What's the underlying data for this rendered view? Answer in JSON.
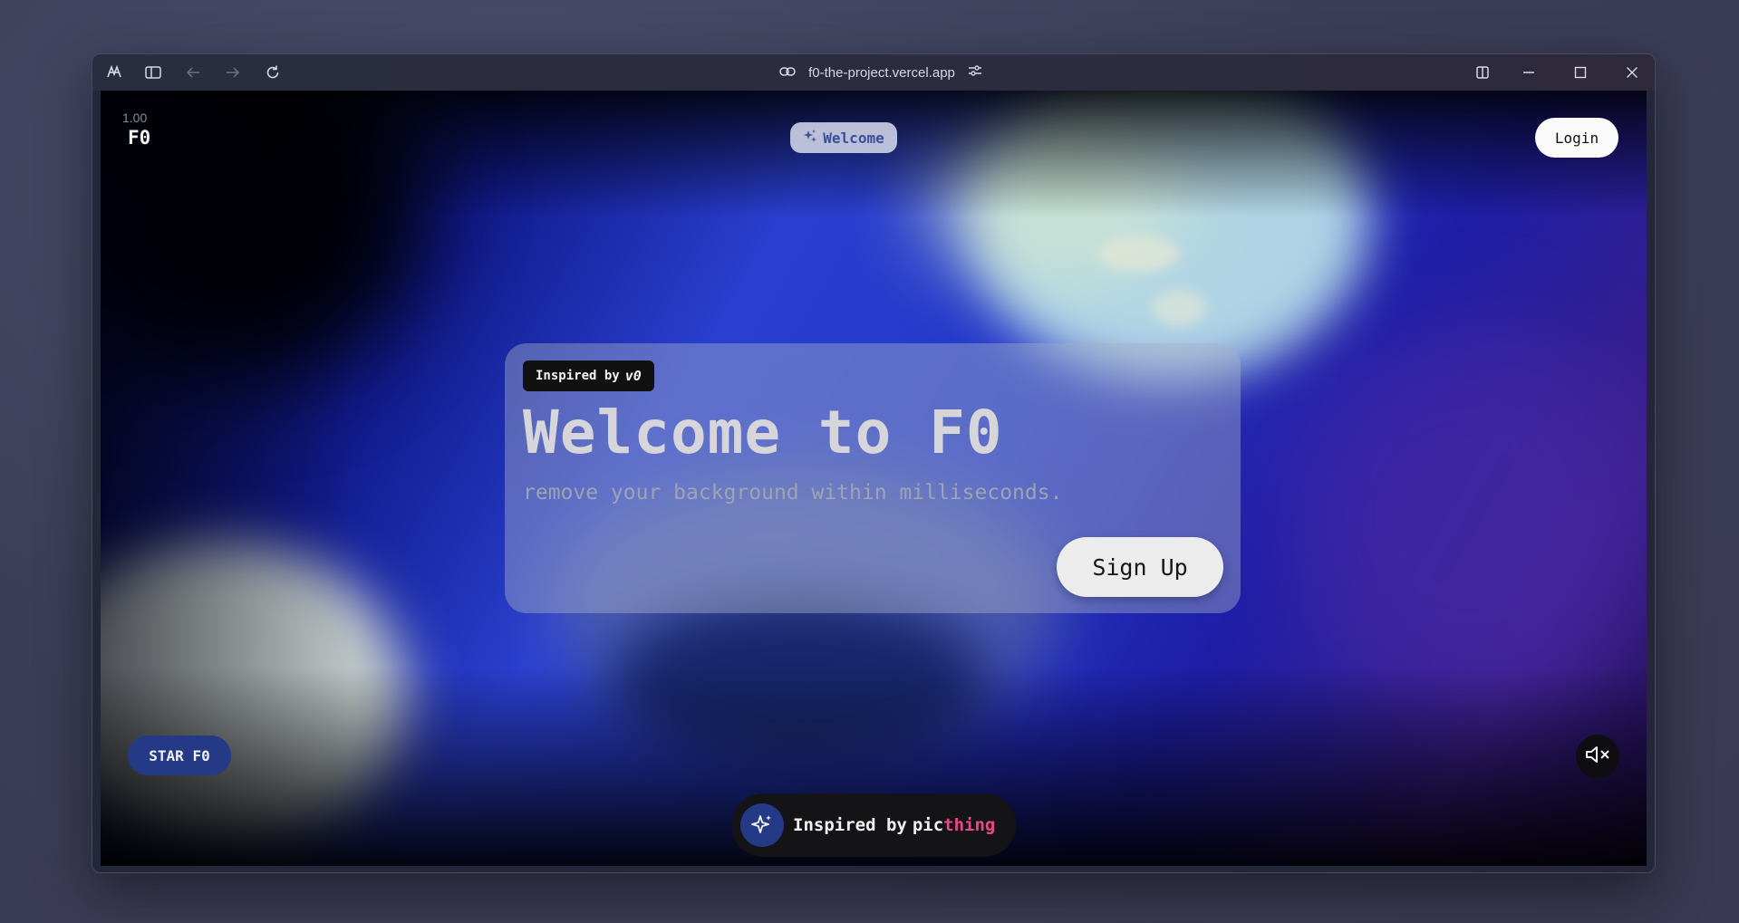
{
  "browser": {
    "url": "f0-the-project.vercel.app",
    "icons": [
      "browser-logo-icon",
      "sidebar-toggle-icon",
      "back-arrow-icon",
      "forward-arrow-icon",
      "reload-icon",
      "link-icon",
      "site-settings-icon",
      "split-view-icon",
      "minimize-icon",
      "maximize-icon",
      "close-icon"
    ]
  },
  "site": {
    "logo_version": "1.00",
    "logo": "F0",
    "welcome_pill": "Welcome",
    "login_label": "Login",
    "card": {
      "inspired_prefix": "Inspired by",
      "inspired_brand": "v0",
      "title": "Welcome to F0",
      "subtitle": "remove your background within milliseconds.",
      "signup_label": "Sign Up"
    },
    "star_label": "STAR F0",
    "bottom_pill": {
      "prefix": "Inspired by",
      "brand_main": "pic",
      "brand_accent": "thing"
    }
  },
  "colors": {
    "accent_blue": "#243a86",
    "brand_pink": "#e8488a"
  }
}
